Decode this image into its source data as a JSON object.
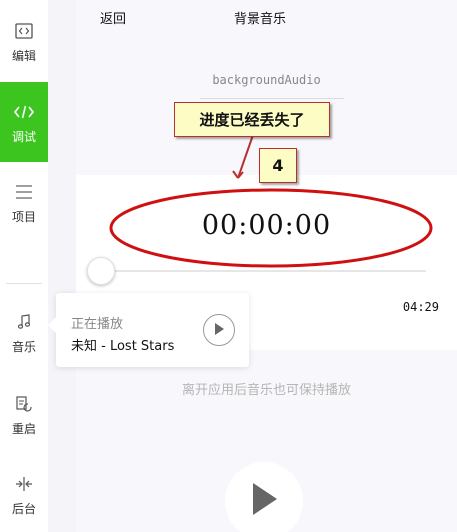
{
  "sidebar": {
    "items": [
      {
        "label": "编辑",
        "icon": "code-bracket-icon"
      },
      {
        "label": "调试",
        "icon": "code-icon"
      },
      {
        "label": "项目",
        "icon": "menu-lines-icon"
      },
      {
        "label": "音乐",
        "icon": "music-note-icon"
      },
      {
        "label": "重启",
        "icon": "restart-icon"
      },
      {
        "label": "后台",
        "icon": "background-split-icon"
      }
    ],
    "active_color": "#3cc51f"
  },
  "nav": {
    "back_label": "返回",
    "title": "背景音乐"
  },
  "content": {
    "bg_audio_label": "backgroundAudio",
    "current_time": "00:00:00",
    "duration": "04:29",
    "hint": "离开应用后音乐也可保持播放"
  },
  "popup": {
    "status": "正在播放",
    "song": "未知 - Lost Stars"
  },
  "annotation": {
    "callout_text": "进度已经丢失了",
    "number": "4",
    "border_color": "#b83030",
    "ellipse_color": "#d01010"
  }
}
